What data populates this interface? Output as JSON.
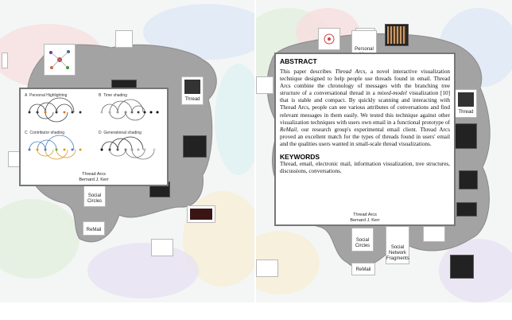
{
  "left_panel": {
    "tiles": {
      "personal_map": "",
      "thread_main": "Thread",
      "social_circles": "Social Circles",
      "remail": "ReMail"
    },
    "figure_card": {
      "panels": [
        {
          "letter": "A",
          "label": "Personal Highlighting"
        },
        {
          "letter": "B",
          "label": "Time shading"
        },
        {
          "letter": "C",
          "label": "Contributor shading"
        },
        {
          "letter": "D",
          "label": "Generational shading"
        }
      ],
      "title": "Thread Arcs",
      "author": "Bernard J. Kerr"
    }
  },
  "right_panel": {
    "tiles": {
      "personal_map": "Personal Map",
      "thread": "Thread",
      "social_circles": "Social Circles",
      "social_network_fragments": "Social Network Fragments",
      "remail": "ReMail"
    },
    "abstract_card": {
      "heading": "ABSTRACT",
      "body_before_1": "This paper describes ",
      "term_thread_arcs": "Thread Arcs",
      "body_after_1": ", a novel interactive visualization technique designed to help people use threads found in email. Thread Arcs combine the chronology of messages with the branching tree structure of a conversational thread in a ",
      "term_mixed_model": "mixed-model",
      "body_after_2": " visualization [10] that is stable and compact. By quickly scanning and interacting with Thread Arcs, people can see various attributes of conversations and find relevant messages in them easily. We tested this technique against other visualization techniques with users own email in a functional prototype of ",
      "term_remail": "ReMail",
      "body_after_3": ", our research group's experimental email client. Thread Arcs proved an excellent match for the types of threads found in users' email and the qualities users wanted in small-scale thread visualizations.",
      "keywords_heading": "KEYWORDS",
      "keywords": "Thread, email, electronic mail, information visualization, tree structures, discussions, conversations.",
      "title": "Thread Arcs",
      "author": "Bernard J. Kerr"
    }
  }
}
